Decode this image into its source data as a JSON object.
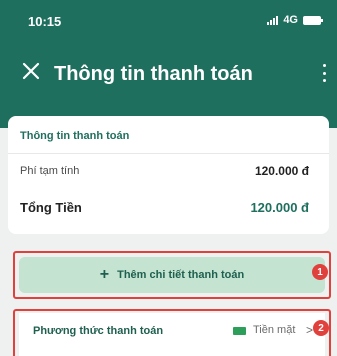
{
  "status_bar": {
    "time": "10:15",
    "network": "4G"
  },
  "header": {
    "title": "Thông tin thanh toán"
  },
  "payment_info": {
    "section_title": "Thông tin thanh toán",
    "subtotal_label": "Phí tạm tính",
    "subtotal_value": "120.000 đ",
    "total_label": "Tổng Tiền",
    "total_value": "120.000 đ"
  },
  "add_detail": {
    "label": "Thêm chi tiết thanh toán",
    "badge": "1"
  },
  "payment_method": {
    "label": "Phương thức thanh toán",
    "value": "Tiền mặt",
    "badge": "2"
  },
  "colors": {
    "header": "#1f6f5f",
    "annotation": "#e0413d",
    "button_bg": "#c4e3d1"
  }
}
